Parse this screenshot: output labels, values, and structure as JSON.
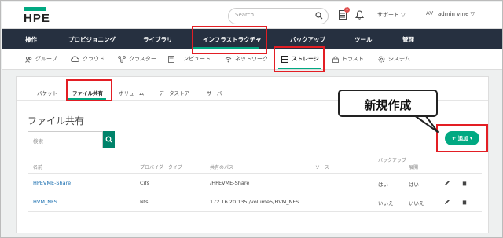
{
  "header": {
    "logo": "HPE",
    "search_placeholder": "Search",
    "notification_count": "1",
    "support_label": "サポート ▽",
    "avatar_initials": "AV",
    "user_label": "admin vme ▽"
  },
  "nav": {
    "items": [
      "操作",
      "プロビジョニング",
      "ライブラリ",
      "インフラストラクチャ",
      "バックアップ",
      "ツール",
      "管理"
    ],
    "active": "インフラストラクチャ"
  },
  "subnav": {
    "items": [
      "グループ",
      "クラウド",
      "クラスター",
      "コンピュート",
      "ネットワーク",
      "ストレージ",
      "トラスト",
      "システム"
    ],
    "active": "ストレージ"
  },
  "tabs": {
    "items": [
      "バケット",
      "ファイル共有",
      "ボリューム",
      "データストア",
      "サーバー"
    ],
    "active": "ファイル共有"
  },
  "page": {
    "title": "ファイル共有",
    "filter_placeholder": "検索",
    "add_button": "+ 追加 ▾"
  },
  "table": {
    "headers": [
      "名前",
      "プロバイダータイプ",
      "共有のパス",
      "ソース",
      "バックアップ",
      "展開"
    ],
    "rows": [
      {
        "name": "HPEVME-Share",
        "provider": "Cifs",
        "path": "/HPEVME-Share",
        "source": "",
        "backup": "はい",
        "deploy": "はい"
      },
      {
        "name": "HVM_NFS",
        "provider": "Nfs",
        "path": "172.16.20.135:/volume5/HVM_NFS",
        "source": "",
        "backup": "いいえ",
        "deploy": "いいえ"
      }
    ]
  },
  "callout": {
    "text": "新規作成"
  },
  "colors": {
    "accent": "#01a982",
    "nav_bg": "#263040",
    "highlight": "#e31e24",
    "link": "#1a6fb0"
  }
}
